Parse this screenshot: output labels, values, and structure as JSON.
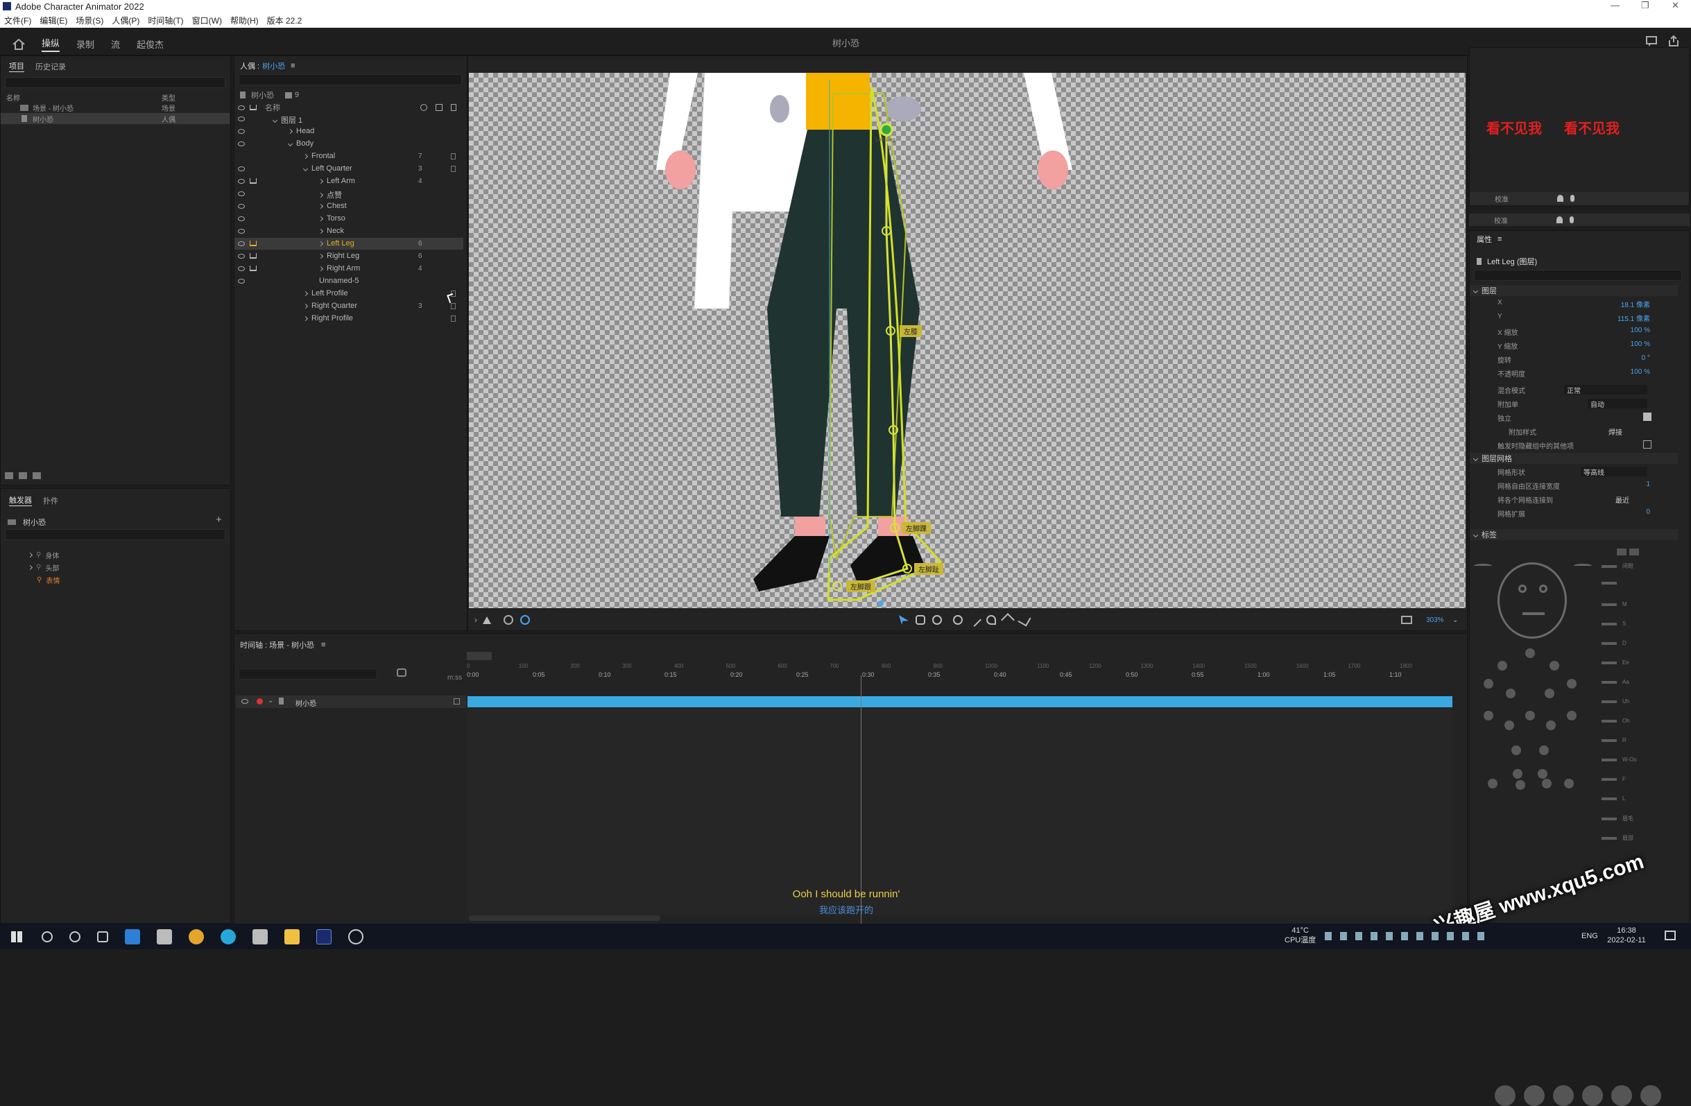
{
  "window": {
    "title": "Adobe Character Animator 2022"
  },
  "menu": [
    "文件(F)",
    "编辑(E)",
    "场景(S)",
    "人偶(P)",
    "时间轴(T)",
    "窗口(W)",
    "帮助(H)",
    "版本 22.2"
  ],
  "workspace": {
    "tabs": [
      "操纵",
      "录制",
      "流",
      "起俊杰"
    ],
    "active": "操纵",
    "center_title": "树小恐"
  },
  "project_panel": {
    "tabs": [
      "项目",
      "历史记录"
    ],
    "columns": [
      "名称",
      "类型"
    ],
    "items": [
      {
        "name": "场景 - 树小恐",
        "type": "场景"
      },
      {
        "name": "树小恐",
        "type": "人偶"
      }
    ]
  },
  "triggers_panel": {
    "tabs": [
      "触发器",
      "扑件"
    ],
    "puppet": "树小恐",
    "items": [
      "身体",
      "头部",
      "表情"
    ]
  },
  "puppet_panel": {
    "title_prefix": "人偶 :",
    "title_name": "树小恐",
    "root": "树小恐",
    "count": "9",
    "header": "名称",
    "rows": [
      {
        "label": "图层 1",
        "indent": 1,
        "chev": "open",
        "eye": true,
        "crown": false,
        "num": ""
      },
      {
        "label": "Head",
        "indent": 2,
        "chev": "closed",
        "eye": true,
        "crown": false,
        "num": ""
      },
      {
        "label": "Body",
        "indent": 2,
        "chev": "open",
        "eye": true,
        "crown": false,
        "num": ""
      },
      {
        "label": "Frontal",
        "indent": 3,
        "chev": "closed",
        "eye": false,
        "crown": false,
        "num": "7"
      },
      {
        "label": "Left Quarter",
        "indent": 3,
        "chev": "open",
        "eye": true,
        "crown": false,
        "num": "3"
      },
      {
        "label": "Left Arm",
        "indent": 4,
        "chev": "closed",
        "eye": true,
        "crown": true,
        "num": "4"
      },
      {
        "label": "点赞",
        "indent": 4,
        "chev": "closed",
        "eye": true,
        "crown": false,
        "num": ""
      },
      {
        "label": "Chest",
        "indent": 4,
        "chev": "closed",
        "eye": true,
        "crown": false,
        "num": ""
      },
      {
        "label": "Torso",
        "indent": 4,
        "chev": "closed",
        "eye": true,
        "crown": false,
        "num": ""
      },
      {
        "label": "Neck",
        "indent": 4,
        "chev": "closed",
        "eye": true,
        "crown": false,
        "num": ""
      },
      {
        "label": "Left Leg",
        "indent": 4,
        "chev": "closed",
        "eye": true,
        "crown": true,
        "num": "6",
        "selected": true
      },
      {
        "label": "Right Leg",
        "indent": 4,
        "chev": "closed",
        "eye": true,
        "crown": true,
        "num": "6"
      },
      {
        "label": "Right Arm",
        "indent": 4,
        "chev": "closed",
        "eye": true,
        "crown": true,
        "num": "4"
      },
      {
        "label": "Unnamed-5",
        "indent": 4,
        "chev": "none",
        "eye": true,
        "crown": false,
        "num": ""
      },
      {
        "label": "Left Profile",
        "indent": 3,
        "chev": "closed",
        "eye": false,
        "crown": false,
        "num": ""
      },
      {
        "label": "Right Quarter",
        "indent": 3,
        "chev": "closed",
        "eye": false,
        "crown": false,
        "num": "3"
      },
      {
        "label": "Right Profile",
        "indent": 3,
        "chev": "closed",
        "eye": false,
        "crown": false,
        "num": ""
      }
    ]
  },
  "viewer": {
    "handles": [
      "左膝",
      "左脚踝",
      "左脚趾",
      "左脚跟"
    ],
    "neck_label": "Left Leg",
    "zoom": "303%"
  },
  "timeline": {
    "title": "时间轴 : 场景 - 树小恐",
    "track": "树小恐",
    "ms_label": "m:ss",
    "frame_ticks": [
      "0",
      "100",
      "200",
      "300",
      "400",
      "500",
      "600",
      "700",
      "800",
      "900",
      "1000",
      "1100",
      "1200",
      "1300",
      "1400",
      "1500",
      "1600",
      "1700",
      "1800"
    ],
    "time_ticks": [
      "0:00",
      "0:05",
      "0:10",
      "0:15",
      "0:20",
      "0:25",
      "0:30",
      "0:35",
      "0:40",
      "0:45",
      "0:50",
      "0:55",
      "1:00",
      "1:05",
      "1:10"
    ],
    "playhead_fraction": 0.4
  },
  "subtitle": {
    "en": "Ooh I should be runnin'",
    "zh": "我应该跑开的"
  },
  "right_top": {
    "red_text_1": "看不见我",
    "red_text_2": "看不见我",
    "row_label": "校准"
  },
  "properties": {
    "tab": "属性",
    "layer_title": "Left Leg (图层)",
    "section_layer": "图层",
    "rows": [
      {
        "k": "X",
        "v": "18.1 像素"
      },
      {
        "k": "Y",
        "v": "115.1 像素"
      },
      {
        "k": "X 缩放",
        "v": "100 %"
      },
      {
        "k": "Y 缩放",
        "v": "100 %"
      },
      {
        "k": "旋转",
        "v": "0 °"
      },
      {
        "k": "不透明度",
        "v": "100 %"
      }
    ],
    "blend_label": "混合模式",
    "blend_value": "正常",
    "attach_label": "附加单",
    "attach_value": "自动",
    "independent_label": "独立",
    "attach_style_label": "附加样式",
    "attach_style_value": "焊接",
    "hide_label": "触发时隐藏组中的其他项",
    "section_mesh": "图层网格",
    "mesh_shape_label": "网格形状",
    "mesh_shape_value": "等高线",
    "mesh_width_label": "网格自由区连接宽度",
    "mesh_width_value": "1",
    "mesh_connect_label": "将各个网格连接到",
    "mesh_connect_value": "最近",
    "mesh_expand_label": "网格扩展",
    "mesh_expand_value": "0",
    "section_tags": "标签",
    "tag_labels": [
      "闭眼",
      "",
      "M",
      "S",
      "D",
      "Ee",
      "Aa",
      "Uh",
      "Oh",
      "R",
      "W-Oo",
      "F",
      "L",
      "眉毛",
      "眉部"
    ]
  },
  "taskbar": {
    "temp": "41°C",
    "temp_label": "CPU温度",
    "lang": "ENG",
    "time": "16:38",
    "date": "2022-02-11"
  },
  "watermark": "兴趣屋 www.xqu5.com"
}
